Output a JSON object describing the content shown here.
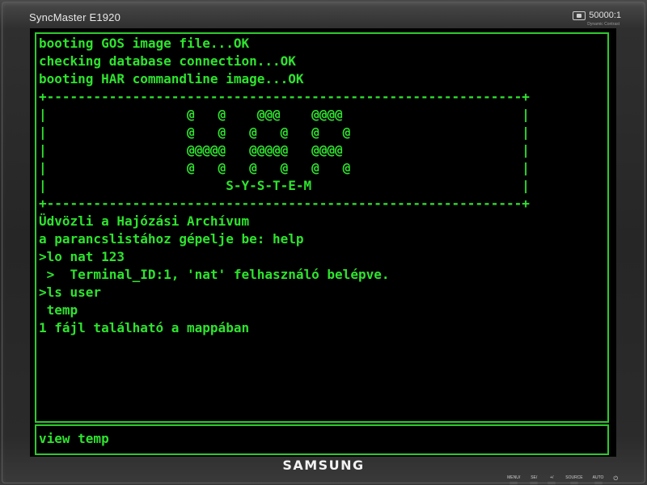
{
  "monitor": {
    "model": "SyncMaster E1920",
    "contrast": "50000:1",
    "contrast_sub": "Dynamic Contrast",
    "brand": "SAMSUNG",
    "controls": [
      "MENU/",
      "SE/",
      "+/",
      "SOURCE",
      "AUTO"
    ],
    "power_icon": "power-icon"
  },
  "terminal": {
    "lines": [
      "booting GOS image file...OK",
      "checking database connection...OK",
      "booting HAR commandline image...OK",
      "+-------------------------------------------------------------+",
      "|                  @   @    @@@    @@@@                       |",
      "|                  @   @   @   @   @   @                      |",
      "|                  @@@@@   @@@@@   @@@@                       |",
      "|                  @   @   @   @   @   @                      |",
      "|                       S-Y-S-T-E-M                           |",
      "+-------------------------------------------------------------+",
      "Üdvözli a Hajózási Archívum",
      "a parancslistához gépelje be: help",
      ">lo nat 123",
      " >  Terminal_ID:1, 'nat' felhasználó belépve.",
      ">ls user",
      " temp",
      "1 fájl található a mappában"
    ],
    "command_input": "view temp"
  },
  "colors": {
    "terminal_text": "#2ee32e",
    "terminal_border": "#2ec92e",
    "screen_bg": "#000000"
  }
}
